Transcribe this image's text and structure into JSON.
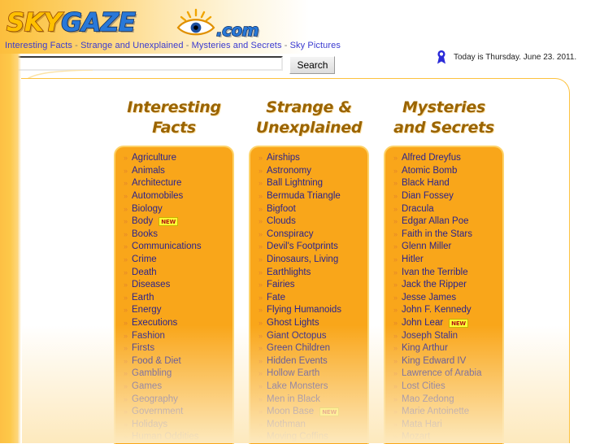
{
  "site": {
    "logo_sky": "SKY",
    "logo_gaze": "GAZE",
    "logo_com": ".com",
    "logo_icon": "eye-with-rays-icon"
  },
  "tagline": {
    "items": [
      "Interesting Facts",
      "Strange and Unexplained",
      "Mysteries and Secrets",
      "Sky Pictures"
    ],
    "separator": " - ",
    "full": "Interesting Facts - Strange and Unexplained - Mysteries and Secrets - Sky Pictures"
  },
  "search": {
    "value": "",
    "placeholder": "",
    "button_label": "Search"
  },
  "date_strip": {
    "icon": "ribbon-award-icon",
    "text": "Today is Thursday. June 23. 2011."
  },
  "colors": {
    "rail": "#fdc044",
    "box_bg": "#f9a61a",
    "box_border": "#fdd268",
    "link": "#2b238c",
    "heading": "#9a6400",
    "badge_bg": "#ffff33",
    "badge_text": "#b21515"
  },
  "columns": [
    {
      "title": "Interesting\nFacts",
      "items": [
        {
          "label": "Agriculture"
        },
        {
          "label": "Animals"
        },
        {
          "label": "Architecture"
        },
        {
          "label": "Automobiles"
        },
        {
          "label": "Biology"
        },
        {
          "label": "Body",
          "badge": "NEW"
        },
        {
          "label": "Books"
        },
        {
          "label": "Communications"
        },
        {
          "label": "Crime"
        },
        {
          "label": "Death"
        },
        {
          "label": "Diseases"
        },
        {
          "label": "Earth"
        },
        {
          "label": "Energy"
        },
        {
          "label": "Executions"
        },
        {
          "label": "Fashion"
        },
        {
          "label": "Firsts"
        },
        {
          "label": "Food & Diet"
        },
        {
          "label": "Gambling"
        },
        {
          "label": "Games"
        },
        {
          "label": "Geography"
        },
        {
          "label": "Government"
        },
        {
          "label": "Holidays"
        },
        {
          "label": "Human Oddities"
        }
      ]
    },
    {
      "title": "Strange &\nUnexplained",
      "items": [
        {
          "label": "Airships"
        },
        {
          "label": "Astronomy"
        },
        {
          "label": "Ball Lightning"
        },
        {
          "label": "Bermuda Triangle"
        },
        {
          "label": "Bigfoot"
        },
        {
          "label": "Clouds"
        },
        {
          "label": "Conspiracy"
        },
        {
          "label": "Devil's Footprints"
        },
        {
          "label": "Dinosaurs, Living"
        },
        {
          "label": "Earthlights"
        },
        {
          "label": "Fairies"
        },
        {
          "label": "Fate"
        },
        {
          "label": "Flying Humanoids"
        },
        {
          "label": "Ghost Lights"
        },
        {
          "label": "Giant Octopus"
        },
        {
          "label": "Green Children"
        },
        {
          "label": "Hidden Events"
        },
        {
          "label": "Hollow Earth"
        },
        {
          "label": "Lake Monsters"
        },
        {
          "label": "Men in Black"
        },
        {
          "label": "Moon Base",
          "badge": "NEW"
        },
        {
          "label": "Mothman"
        },
        {
          "label": "Moving Coffins"
        }
      ]
    },
    {
      "title": "Mysteries\nand Secrets",
      "items": [
        {
          "label": "Alfred Dreyfus"
        },
        {
          "label": "Atomic Bomb"
        },
        {
          "label": "Black Hand"
        },
        {
          "label": "Dian Fossey"
        },
        {
          "label": "Dracula"
        },
        {
          "label": "Edgar Allan Poe"
        },
        {
          "label": "Faith in the Stars"
        },
        {
          "label": "Glenn Miller"
        },
        {
          "label": "Hitler"
        },
        {
          "label": "Ivan the Terrible"
        },
        {
          "label": "Jack the Ripper"
        },
        {
          "label": "Jesse James"
        },
        {
          "label": "John F. Kennedy"
        },
        {
          "label": "John Lear",
          "badge": "NEW"
        },
        {
          "label": "Joseph Stalin"
        },
        {
          "label": "King Arthur"
        },
        {
          "label": "King Edward IV"
        },
        {
          "label": "Lawrence of Arabia"
        },
        {
          "label": "Lost Cities"
        },
        {
          "label": "Mao Zedong"
        },
        {
          "label": "Marie Antoinette"
        },
        {
          "label": "Mata Hari"
        },
        {
          "label": "Mozart"
        }
      ]
    }
  ]
}
